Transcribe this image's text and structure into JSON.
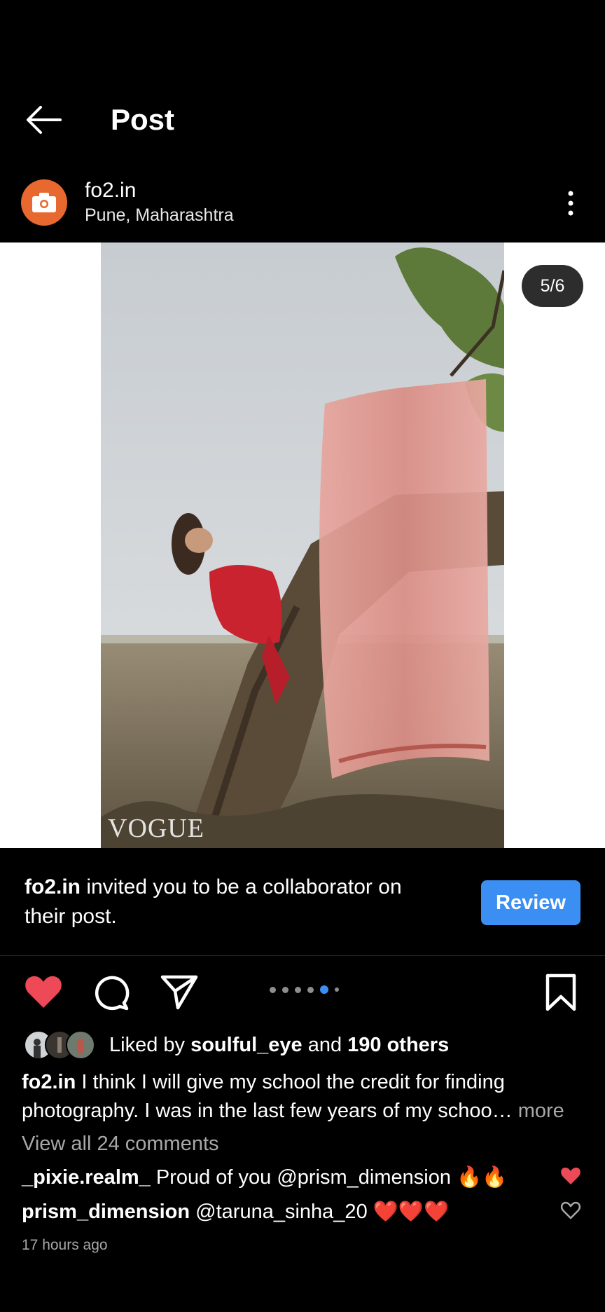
{
  "header": {
    "title": "Post"
  },
  "author": {
    "username": "fo2.in",
    "location": "Pune, Maharashtra"
  },
  "post": {
    "counter": "5/6",
    "watermark": "VOGUE",
    "slide_count": 6,
    "active_slide": 5
  },
  "collab": {
    "username": "fo2.in",
    "message": " invited you to be a collaborator on their post.",
    "button": "Review"
  },
  "likes": {
    "prefix": "Liked by ",
    "user": "soulful_eye",
    "middle": " and ",
    "others": "190 others"
  },
  "caption": {
    "username": "fo2.in",
    "text": " I think I will give my school the credit for finding photography. I was in the last few years of my schoo…",
    "more": " more"
  },
  "comments_link": "View all 24 comments",
  "comments": [
    {
      "username": "_pixie.realm_",
      "text": " Proud of you @prism_dimension 🔥🔥",
      "liked": true
    },
    {
      "username": "prism_dimension",
      "text": " @taruna_sinha_20 ❤️❤️❤️",
      "liked": false
    }
  ],
  "timestamp": "17 hours ago",
  "colors": {
    "accent": "#3b8ff3",
    "like": "#ed4956",
    "avatar": "#e8692f"
  },
  "icons": {
    "back": "arrow-left-icon",
    "more": "three-dots-vertical-icon",
    "like": "heart-filled-icon",
    "comment": "speech-bubble-icon",
    "share": "paper-plane-icon",
    "save": "bookmark-icon"
  }
}
